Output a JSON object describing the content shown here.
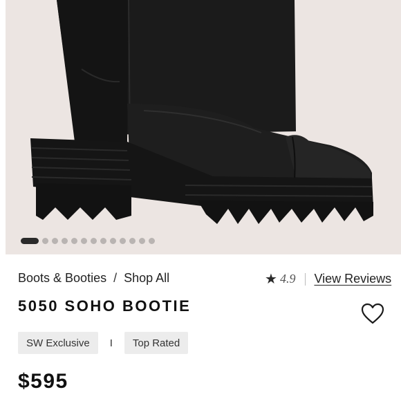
{
  "product_image": {
    "subject": "black leather lug-sole ankle bootie",
    "slide_count": 13,
    "active_slide": 1
  },
  "breadcrumb": {
    "items": [
      "Boots & Booties",
      "Shop All"
    ],
    "separator": "/"
  },
  "rating": {
    "score": "4.9",
    "reviews_link": "View Reviews",
    "star_icon": "star-icon"
  },
  "product": {
    "title": "5050 SOHO BOOTIE",
    "price": "$595"
  },
  "tags": {
    "items": [
      "SW Exclusive",
      "Top Rated"
    ],
    "separator": "I"
  },
  "wishlist": {
    "icon": "heart-icon"
  },
  "colors": {
    "image_background": "#ece5e2",
    "text": "#1a1a1a",
    "tag_background": "#ececec"
  }
}
